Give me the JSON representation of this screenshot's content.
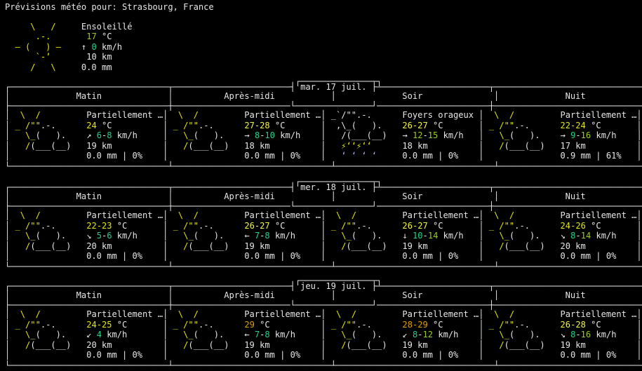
{
  "header": {
    "title": "Prévisions météo pour: Strasbourg, France"
  },
  "current": {
    "condition": "Ensoleillé",
    "temp": "17",
    "temp_unit": "°C",
    "wind_arrow": "↑",
    "wind": "0",
    "wind_unit": "km/h",
    "visibility": "10 km",
    "precip": "0.0 mm"
  },
  "column_headers": [
    "Matin",
    "Après-midi",
    "Soir",
    "Nuit"
  ],
  "days": [
    {
      "date": "mar. 17 juil.",
      "periods": [
        {
          "icon": "partly-cloudy",
          "condition": "Partiellement …",
          "temp": "24",
          "temp_unit": "°C",
          "wind_arrow": "↗",
          "wind_min": "6",
          "wind_max": "8",
          "wind_unit": "km/h",
          "visibility": "19 km",
          "precip": "0.0 mm",
          "chance": "0%"
        },
        {
          "icon": "partly-cloudy",
          "condition": "Partiellement …",
          "temp": "27-28",
          "temp_unit": "°C",
          "wind_arrow": "→",
          "wind_min": "8",
          "wind_max": "10",
          "wind_unit": "km/h",
          "visibility": "18 km",
          "precip": "0.0 mm",
          "chance": "0%"
        },
        {
          "icon": "thunder",
          "condition": "Foyers orageux",
          "temp": "26-27",
          "temp_unit": "°C",
          "wind_arrow": "→",
          "wind_min": "12",
          "wind_max": "15",
          "wind_unit": "km/h",
          "visibility": "18 km",
          "precip": "0.0 mm",
          "chance": "0%"
        },
        {
          "icon": "partly-cloudy",
          "condition": "Partiellement …",
          "temp": "22-24",
          "temp_unit": "°C",
          "wind_arrow": "→",
          "wind_min": "9",
          "wind_max": "16",
          "wind_unit": "km/h",
          "visibility": "17 km",
          "precip": "0.9 mm",
          "chance": "61%"
        }
      ]
    },
    {
      "date": "mer. 18 juil.",
      "periods": [
        {
          "icon": "partly-cloudy",
          "condition": "Partiellement …",
          "temp": "22-23",
          "temp_unit": "°C",
          "wind_arrow": "↘",
          "wind_min": "5",
          "wind_max": "6",
          "wind_unit": "km/h",
          "visibility": "20 km",
          "precip": "0.0 mm",
          "chance": "0%"
        },
        {
          "icon": "partly-cloudy",
          "condition": "Partiellement …",
          "temp": "26-27",
          "temp_unit": "°C",
          "wind_arrow": "←",
          "wind_min": "7",
          "wind_max": "8",
          "wind_unit": "km/h",
          "visibility": "19 km",
          "precip": "0.0 mm",
          "chance": "0%"
        },
        {
          "icon": "partly-cloudy",
          "condition": "Partiellement …",
          "temp": "26-27",
          "temp_unit": "°C",
          "wind_arrow": "↓",
          "wind_min": "10",
          "wind_max": "14",
          "wind_unit": "km/h",
          "visibility": "19 km",
          "precip": "0.0 mm",
          "chance": "0%"
        },
        {
          "icon": "partly-cloudy",
          "condition": "Partiellement …",
          "temp": "24-26",
          "temp_unit": "°C",
          "wind_arrow": "↘",
          "wind_min": "8",
          "wind_max": "14",
          "wind_unit": "km/h",
          "visibility": "20 km",
          "precip": "0.0 mm",
          "chance": "0%"
        }
      ]
    },
    {
      "date": "jeu. 19 juil.",
      "periods": [
        {
          "icon": "partly-cloudy",
          "condition": "Partiellement …",
          "temp": "24-25",
          "temp_unit": "°C",
          "wind_arrow": "↙",
          "wind_min": "",
          "wind_max": "4",
          "wind_unit": "km/h",
          "visibility": "20 km",
          "precip": "0.0 mm",
          "chance": "0%"
        },
        {
          "icon": "partly-cloudy",
          "condition": "Partiellement …",
          "temp": "29",
          "temp_unit": "°C",
          "wind_arrow": "←",
          "wind_min": "7",
          "wind_max": "8",
          "wind_unit": "km/h",
          "visibility": "19 km",
          "precip": "0.0 mm",
          "chance": "0%"
        },
        {
          "icon": "partly-cloudy",
          "condition": "Partiellement …",
          "temp": "28-29",
          "temp_unit": "°C",
          "wind_arrow": "↙",
          "wind_min": "8",
          "wind_max": "12",
          "wind_unit": "km/h",
          "visibility": "19 km",
          "precip": "0.0 mm",
          "chance": "0%"
        },
        {
          "icon": "partly-cloudy",
          "condition": "Partiellement …",
          "temp": "26-28",
          "temp_unit": "°C",
          "wind_arrow": "↘",
          "wind_min": "8",
          "wind_max": "16",
          "wind_unit": "km/h",
          "visibility": "19 km",
          "precip": "0.0 mm",
          "chance": "0%"
        }
      ]
    }
  ],
  "colors": {
    "sun": "#e5e510",
    "cloud": "#e6e6e6",
    "rain": "#aab4ff",
    "background": "#000000",
    "text": "#e6e6e6"
  }
}
